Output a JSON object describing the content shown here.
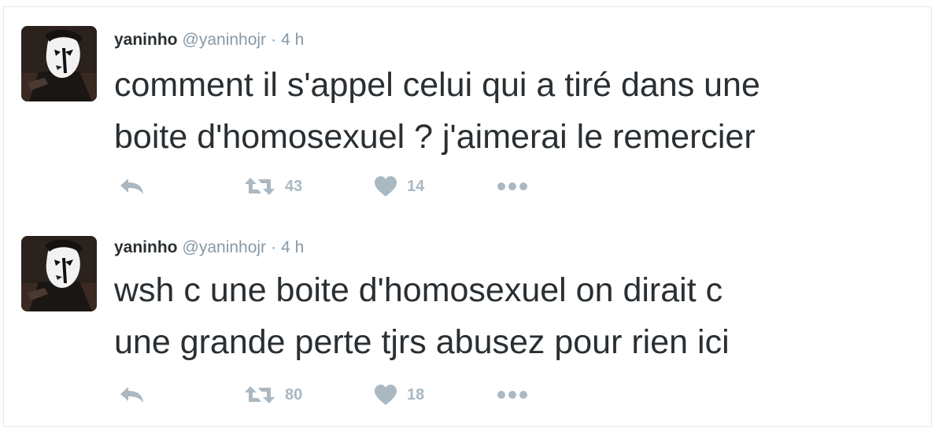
{
  "tweets": [
    {
      "fullname": "yaninho",
      "username": "@yaninhojr",
      "separator": "·",
      "time": "4 h",
      "text": "comment il s'appel celui qui a tiré dans une\nboite d'homosexuel ? j'aimerai le remercier",
      "retweets": "43",
      "likes": "14"
    },
    {
      "fullname": "yaninho",
      "username": "@yaninhojr",
      "separator": "·",
      "time": "4 h",
      "text": "wsh c une boite d'homosexuel on dirait c\nune grande perte tjrs abusez pour rien ici",
      "retweets": "80",
      "likes": "18"
    }
  ],
  "icons": {
    "reply": "reply-icon",
    "retweet": "retweet-icon",
    "like": "heart-icon",
    "more": "more-icon"
  },
  "colors": {
    "text": "#292f33",
    "muted": "#8899a6",
    "icon": "#aab8c2",
    "border": "#e1e8ed"
  }
}
